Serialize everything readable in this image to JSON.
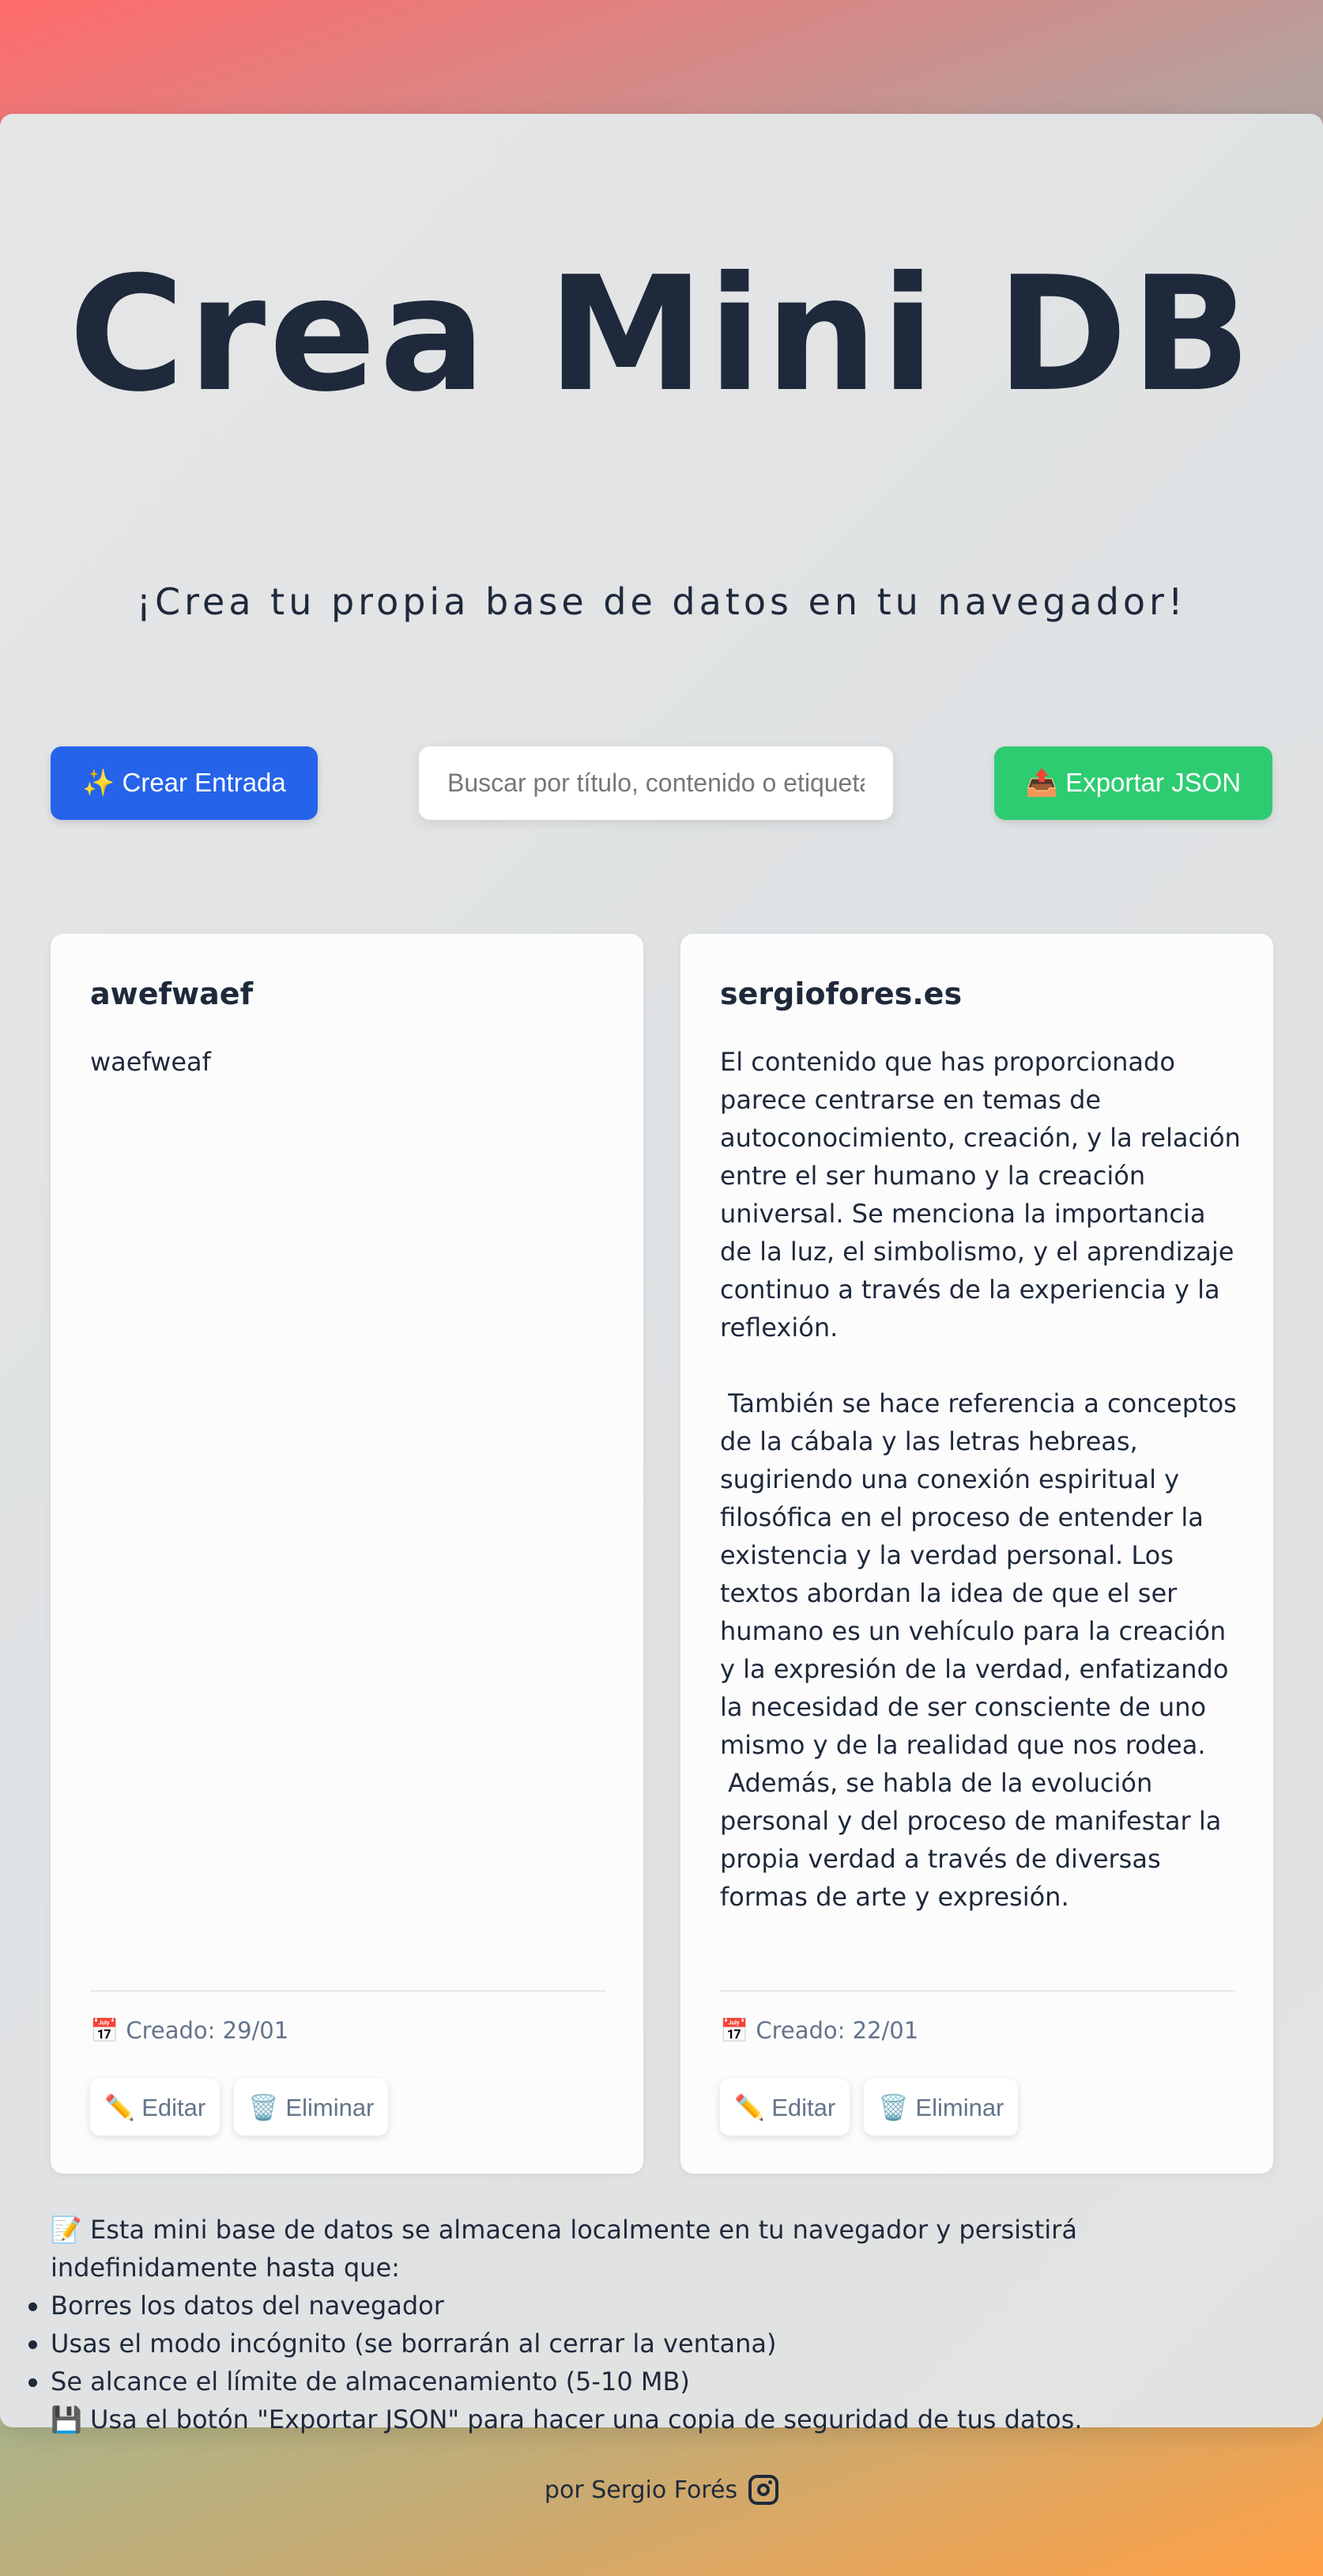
{
  "header": {
    "title": "Crea Mini DB",
    "subtitle": "¡Crea tu propia base de datos en tu navegador!"
  },
  "toolbar": {
    "create_label": "✨ Crear Entrada",
    "search_placeholder": "Buscar por título, contenido o etiquetas...",
    "export_label": "📤 Exportar JSON"
  },
  "entries": [
    {
      "title": "awefwaef",
      "content": "waefweaf",
      "date": "📅 Creado: 29/01",
      "edit_label": "✏️ Editar",
      "delete_label": "🗑️ Eliminar"
    },
    {
      "title": "sergiofores.es",
      "content": "El contenido que has proporcionado parece centrarse en temas de autoconocimiento, creación, y la relación entre el ser humano y la creación universal. Se menciona la importancia de la luz, el simbolismo, y el aprendizaje continuo a través de la experiencia y la reflexión.\n\n También se hace referencia a conceptos de la cábala y las letras hebreas, sugiriendo una conexión espiritual y filosófica en el proceso de entender la existencia y la verdad personal. Los textos abordan la idea de que el ser humano es un vehículo para la creación y la expresión de la verdad, enfatizando la necesidad de ser consciente de uno mismo y de la realidad que nos rodea.\n Además, se habla de la evolución personal y del proceso de manifestar la propia verdad a través de diversas formas de arte y expresión.",
      "date": "📅 Creado: 22/01",
      "edit_label": "✏️ Editar",
      "delete_label": "🗑️ Eliminar"
    }
  ],
  "info": {
    "intro": "📝 Esta mini base de datos se almacena localmente en tu navegador y persistirá indefinidamente hasta que:",
    "items": [
      "Borres los datos del navegador",
      "Usas el modo incógnito (se borrarán al cerrar la ventana)",
      "Se alcance el límite de almacenamiento (5-10 MB)"
    ],
    "backup": "💾 Usa el botón \"Exportar JSON\" para hacer una copia de seguridad de tus datos."
  },
  "footer": {
    "credit": "por Sergio Forés",
    "icon": "instagram-icon"
  },
  "colors": {
    "create_button": "#2563eb",
    "export_button": "#2ecc71",
    "text": "#1e293b"
  }
}
